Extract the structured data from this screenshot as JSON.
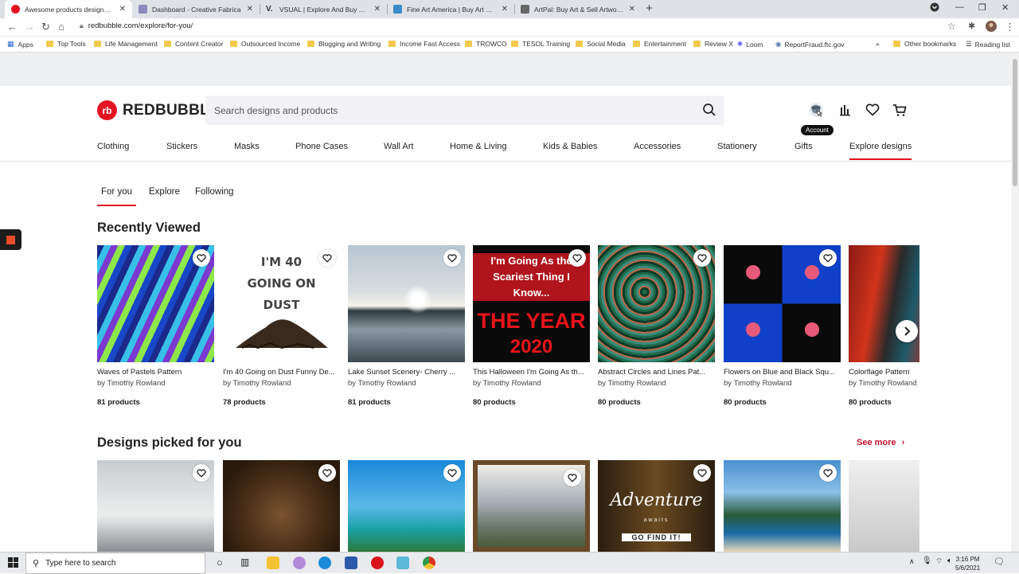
{
  "browser": {
    "tabs": [
      {
        "title": "Awesome products designed by",
        "icon": "redbubble-icon",
        "color": "#e41321",
        "active": true
      },
      {
        "title": "Dashboard - Creative Fabrica",
        "icon": "creative-fabrica-icon",
        "color": "#6b6b9a"
      },
      {
        "title": "VSUAL | Explore And Buy Art Prin",
        "icon": "vsual-icon",
        "color": "#222222"
      },
      {
        "title": "Fine Art America | Buy Art Online",
        "icon": "fineartamerica-icon",
        "color": "#3a8bc8"
      },
      {
        "title": "ArtPal: Buy Art & Sell Artwork On",
        "icon": "artpal-icon",
        "color": "#555555"
      }
    ],
    "url": "redbubble.com/explore/for-you/",
    "bookmarks": [
      "Apps",
      "Top Tools",
      "Life Management",
      "Content Creator",
      "Outsourced Income",
      "Blogging and Writing",
      "Income Fast Access",
      "TROWCO",
      "TESOL Training",
      "Social Media",
      "Entertainment",
      "Review X",
      "Loom",
      "ReportFraud.ftc.gov"
    ],
    "other_bookmarks": "Other bookmarks",
    "reading_list": "Reading list"
  },
  "site": {
    "logo_text": "REDBUBBLE",
    "logo_mark": "rb",
    "search_placeholder": "Search designs and products",
    "account_tooltip": "Account",
    "categories": [
      "Clothing",
      "Stickers",
      "Masks",
      "Phone Cases",
      "Wall Art",
      "Home & Living",
      "Kids & Babies",
      "Accessories",
      "Stationery",
      "Gifts",
      "Explore designs"
    ],
    "subtabs": [
      "For you",
      "Explore",
      "Following"
    ]
  },
  "recently_viewed": {
    "title": "Recently Viewed",
    "items": [
      {
        "name": "Waves of Pastels Pattern",
        "by": "by Timothy Rowland",
        "count": "81 products"
      },
      {
        "name": "I'm 40 Going on Dust Funny De...",
        "by": "by Timothy Rowland",
        "count": "78 products"
      },
      {
        "name": "Lake Sunset Scenery- Cherry ...",
        "by": "by Timothy Rowland",
        "count": "81 products"
      },
      {
        "name": "This Halloween I'm Going As th...",
        "by": "by Timothy Rowland",
        "count": "80 products"
      },
      {
        "name": "Abstract Circles and Lines Pat...",
        "by": "by Timothy Rowland",
        "count": "80 products"
      },
      {
        "name": "Flowers on Blue and Black Squ...",
        "by": "by Timothy Rowland",
        "count": "80 products"
      },
      {
        "name": "Colorflage Pattern",
        "by": "by Timothy Rowland",
        "count": "80 products"
      }
    ],
    "art_text": {
      "dust_lines": [
        "I'M 40",
        "GOING ON",
        "DUST"
      ],
      "halloween_lines": [
        "I'm Going As the",
        "Scariest Thing I",
        "Know...",
        "THE YEAR",
        "2020"
      ]
    }
  },
  "picked": {
    "title": "Designs picked for you",
    "see_more": "See more",
    "adventure_text": "Adventure",
    "adventure_sub": "awaits",
    "adventure_btn": "GO FIND IT!"
  },
  "taskbar": {
    "search_placeholder": "Type here to search",
    "time": "3:16 PM",
    "date": "5/6/2021"
  }
}
